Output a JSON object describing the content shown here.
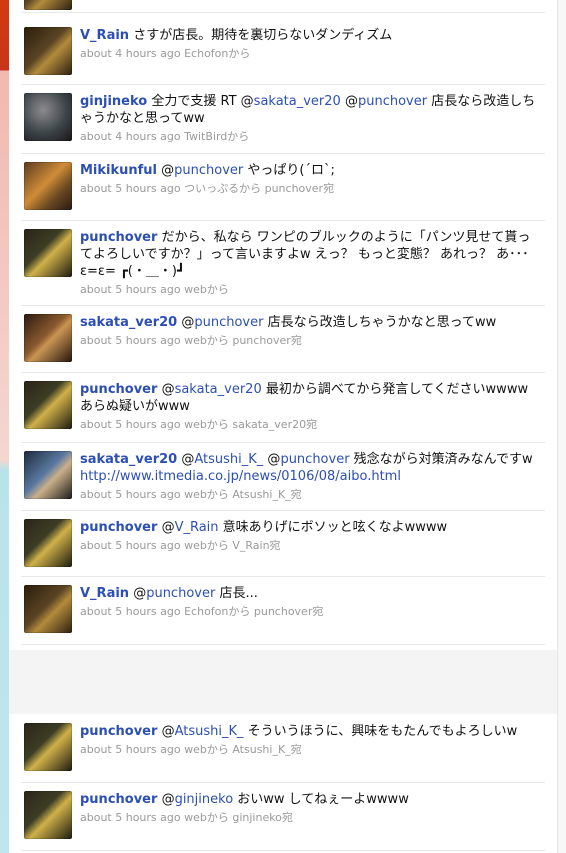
{
  "tweets": [
    {
      "user": "V_Rain",
      "parts": [
        {
          "t": "text",
          "v": "さすが店長。期待を裏切らないダンディズム"
        }
      ],
      "meta": "about 4 hours ago Echofonから"
    },
    {
      "user": "ginjineko",
      "parts": [
        {
          "t": "text",
          "v": "全力で支援 RT @"
        },
        {
          "t": "mention",
          "v": "sakata_ver20"
        },
        {
          "t": "text",
          "v": " @"
        },
        {
          "t": "mention",
          "v": "punchover"
        },
        {
          "t": "text",
          "v": " 店長なら改造しちゃうかなと思ってww"
        }
      ],
      "meta": "about 4 hours ago TwitBirdから"
    },
    {
      "user": "Mikikunful",
      "parts": [
        {
          "t": "text",
          "v": "@"
        },
        {
          "t": "mention",
          "v": "punchover"
        },
        {
          "t": "text",
          "v": " やっぱり(´ロ`;"
        }
      ],
      "meta": "about 5 hours ago ついっぷるから punchover宛"
    },
    {
      "user": "punchover",
      "parts": [
        {
          "t": "text",
          "v": "だから、私なら ワンピのブルックのように「パンツ見せて貰ってよろしいですか？」って言いますよw えっ？ もっと変態？ あれっ？ あ･･･ ε=ε= ┏(・＿・)┛"
        }
      ],
      "meta": "about 5 hours ago webから"
    },
    {
      "user": "sakata_ver20",
      "parts": [
        {
          "t": "text",
          "v": "@"
        },
        {
          "t": "mention",
          "v": "punchover"
        },
        {
          "t": "text",
          "v": " 店長なら改造しちゃうかなと思ってww"
        }
      ],
      "meta": "about 5 hours ago webから punchover宛"
    },
    {
      "user": "punchover",
      "parts": [
        {
          "t": "text",
          "v": "@"
        },
        {
          "t": "mention",
          "v": "sakata_ver20"
        },
        {
          "t": "text",
          "v": " 最初から調べてから発言してくださいwwww あらぬ疑いがwww"
        }
      ],
      "meta": "about 5 hours ago webから sakata_ver20宛"
    },
    {
      "user": "sakata_ver20",
      "parts": [
        {
          "t": "text",
          "v": "@"
        },
        {
          "t": "mention",
          "v": "Atsushi_K_"
        },
        {
          "t": "text",
          "v": " @"
        },
        {
          "t": "mention",
          "v": "punchover"
        },
        {
          "t": "text",
          "v": " 残念ながら対策済みなんですw "
        },
        {
          "t": "link",
          "v": "http://www.itmedia.co.jp/news/0106/08/aibo.html"
        }
      ],
      "meta": "about 5 hours ago webから Atsushi_K_宛"
    },
    {
      "user": "punchover",
      "parts": [
        {
          "t": "text",
          "v": "@"
        },
        {
          "t": "mention",
          "v": "V_Rain"
        },
        {
          "t": "text",
          "v": " 意味ありげにボソッと呟くなよwwww"
        }
      ],
      "meta": "about 5 hours ago webから V_Rain宛"
    },
    {
      "user": "V_Rain",
      "parts": [
        {
          "t": "text",
          "v": "@"
        },
        {
          "t": "mention",
          "v": "punchover"
        },
        {
          "t": "text",
          "v": " 店長..."
        }
      ],
      "meta": "about 5 hours ago Echofonから punchover宛"
    },
    {
      "user": "punchover",
      "parts": [
        {
          "t": "text",
          "v": "@"
        },
        {
          "t": "mention",
          "v": "Atsushi_K_"
        },
        {
          "t": "text",
          "v": " そういうほうに、興味をもたんでもよろしいw"
        }
      ],
      "meta": "about 5 hours ago webから Atsushi_K_宛"
    },
    {
      "user": "punchover",
      "parts": [
        {
          "t": "text",
          "v": "@"
        },
        {
          "t": "mention",
          "v": "ginjineko"
        },
        {
          "t": "text",
          "v": " おいww してねぇーよwwww"
        }
      ],
      "meta": "about 5 hours ago webから ginjineko宛"
    }
  ],
  "colors": {
    "link": "#2c4fb3",
    "meta": "#9a9a9a",
    "divider": "#e8e8e8"
  }
}
